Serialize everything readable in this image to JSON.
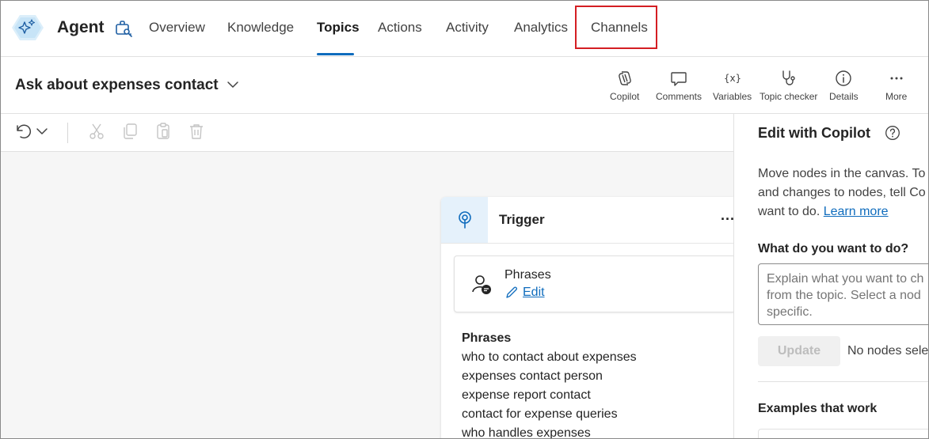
{
  "app": {
    "agent_name": "Agent",
    "tabs": [
      {
        "label": "Overview"
      },
      {
        "label": "Knowledge"
      },
      {
        "label": "Topics"
      },
      {
        "label": "Actions"
      },
      {
        "label": "Activity"
      },
      {
        "label": "Analytics"
      },
      {
        "label": "Channels"
      }
    ],
    "active_tab": "Topics",
    "highlighted_tab": "Channels"
  },
  "topic": {
    "title": "Ask about expenses contact",
    "tools": [
      {
        "label": "Copilot",
        "icon": "copilot-icon"
      },
      {
        "label": "Comments",
        "icon": "comment-icon"
      },
      {
        "label": "Variables",
        "icon": "variables-icon"
      },
      {
        "label": "Topic checker",
        "icon": "stethoscope-icon"
      },
      {
        "label": "Details",
        "icon": "info-icon"
      },
      {
        "label": "More",
        "icon": "more-icon"
      }
    ]
  },
  "canvas": {
    "node": {
      "title": "Trigger",
      "more_label": "···",
      "card_title": "Phrases",
      "edit_label": "Edit",
      "phrase_heading": "Phrases",
      "phrases": [
        "who to contact about expenses",
        "expenses contact person",
        "expense report contact",
        "contact for expense queries",
        "who handles expenses"
      ]
    }
  },
  "panel": {
    "title": "Edit with Copilot",
    "desc_lines": [
      "Move nodes in the canvas. To",
      "and changes to nodes, tell Co",
      "want to do."
    ],
    "learn_more": "Learn more",
    "question": "What do you want to do?",
    "placeholder": "Explain what you want to ch\nfrom the topic. Select a nod\nspecific.",
    "update_label": "Update",
    "no_nodes": "No nodes sele",
    "examples_title": "Examples that work"
  },
  "colors": {
    "accent": "#0f6cbd",
    "highlight": "#d41e23",
    "canvas_bg": "#f6f6f6",
    "trigger_bg": "#e5f1fb"
  }
}
